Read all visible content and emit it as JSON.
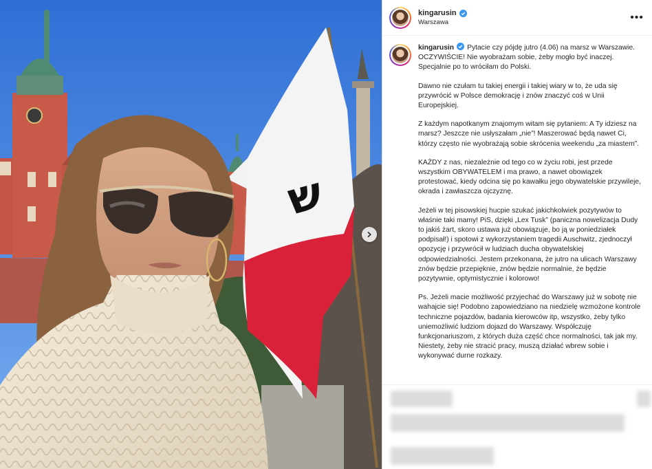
{
  "post": {
    "username": "kingarusin",
    "location": "Warszawa",
    "more_label": "•••",
    "caption": [
      "Pytacie czy pójdę jutro (4.06) na marsz w Warszawie. OCZYWIŚCIE! Nie wyobrażam sobie, żeby mogło być inaczej. Specjalnie po to wróciłam do Polski.",
      "Dawno nie czułam tu takiej energii i takiej wiary w to, że uda się przywrócić w Polsce demokrację i znów znaczyć coś w Unii Europejskiej.",
      "Z każdym napotkanym znajomym witam się pytaniem: A Ty idziesz na marsz? Jeszcze nie usłyszałam „nie”! Maszerować będą nawet Ci, którzy często nie wyobrażają sobie skrócenia weekendu „za miastem”.",
      "KAŻDY z nas, niezależnie od tego co w życiu robi, jest przede wszystkim OBYWATELEM i ma prawo, a nawet obowiązek protestować, kiedy odcina się po kawałku jego obywatelskie przywileje, okrada i zawłaszcza ojczyznę.",
      "Jeżeli w tej pisowskiej hucpie szukać jakichkolwiek pozytywów to właśnie taki mamy! PiS, dzięki „Lex Tusk” (paniczna nowelizacja Dudy to jakiś żart, skoro ustawa już obowiązuje, bo ją w poniedziałek podpisał!) i spotowi z wykorzystaniem tragedii Auschwitz, zjednoczył opozycję i przywrócił w ludziach ducha obywatelskiej odpowiedzialności. Jestem przekonana, że jutro na ulicach Warszawy znów będzie przepięknie, znów będzie normalnie, że będzie pozytywnie, optymistycznie i kolorowo!",
      "Ps. Jeżeli macie możliwość przyjechać do Warszawy już w sobotę nie wahajcie się! Podobno zapowiedziano na niedzielę wzmożone kontrole techniczne pojazdów, badania kierowców itp, wszystko, żeby tylko uniemożliwić ludziom dojazd do Warszawy. Współczuję funkcjonariuszom, z których duża część chce normalności, tak jak my. Niestety, żeby nie stracić pracy, muszą działać wbrew sobie i wykonywać durne rozkazy."
    ]
  },
  "colors": {
    "verified": "#3897f0",
    "text": "#262626",
    "flag_red": "#d9213a",
    "sky": "#3f7fd9"
  },
  "icons": {
    "verified": "verified-badge-icon",
    "next": "chevron-right-icon"
  }
}
